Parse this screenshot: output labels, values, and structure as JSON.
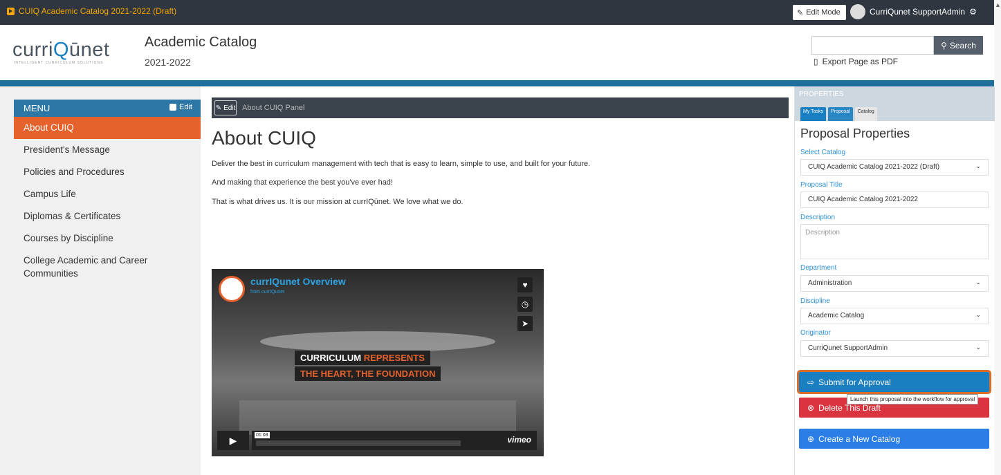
{
  "topbar": {
    "catalog_title": "CUIQ Academic Catalog 2021-2022 (Draft)",
    "edit_mode_label": "Edit Mode",
    "user_name": "CurriQunet SupportAdmin"
  },
  "header": {
    "logo_text_pre": "curri",
    "logo_text_q": "Q",
    "logo_text_post": "ūnet",
    "logo_sub": "INTELLIGENT CURRICULUM SOLUTIONS",
    "title": "Academic Catalog",
    "year": "2021-2022",
    "search_button": "Search",
    "export_label": "Export Page as PDF"
  },
  "menu": {
    "title": "MENU",
    "edit_label": "Edit",
    "items": [
      {
        "label": "About CUIQ",
        "active": true
      },
      {
        "label": "President's Message"
      },
      {
        "label": "Policies and Procedures"
      },
      {
        "label": "Campus Life"
      },
      {
        "label": "Diplomas & Certificates"
      },
      {
        "label": "Courses by Discipline"
      },
      {
        "label": "College Academic and Career Communities"
      }
    ]
  },
  "main": {
    "panel_edit_label": "Edit",
    "panel_title": "About CUIQ Panel",
    "heading": "About CUIQ",
    "paragraphs": [
      "Deliver the best in curriculum management with tech that is easy to learn, simple to use, and built for your future.",
      "And making that experience the best you've ever had!",
      "That is what drives us. It is our mission at currIQūnet.  We love what we do."
    ],
    "video": {
      "title": "currIQunet Overview",
      "from_label": "from",
      "from_name": "currIQunet",
      "caption_word1": "CURRICULUM",
      "caption_word2": "REPRESENTS",
      "caption_line2": "THE HEART, THE FOUNDATION",
      "time": "01:08",
      "brand": "vimeo"
    }
  },
  "properties": {
    "header": "PROPERTIES",
    "tabs": [
      "My Tasks",
      "Proposal",
      "Catalog"
    ],
    "title": "Proposal Properties",
    "select_catalog_label": "Select Catalog",
    "select_catalog_value": "CUIQ Academic Catalog 2021-2022 (Draft)",
    "proposal_title_label": "Proposal Title",
    "proposal_title_value": "CUIQ Academic Catalog 2021-2022",
    "description_label": "Description",
    "description_placeholder": "Description",
    "department_label": "Department",
    "department_value": "Administration",
    "discipline_label": "Discipline",
    "discipline_value": "Academic Catalog",
    "originator_label": "Originator",
    "originator_value": "CurriQunet SupportAdmin",
    "submit_label": "Submit for Approval",
    "submit_tooltip": "Launch this proposal into the workflow for approval",
    "delete_label": "Delete This Draft",
    "create_label": "Create a New Catalog"
  }
}
